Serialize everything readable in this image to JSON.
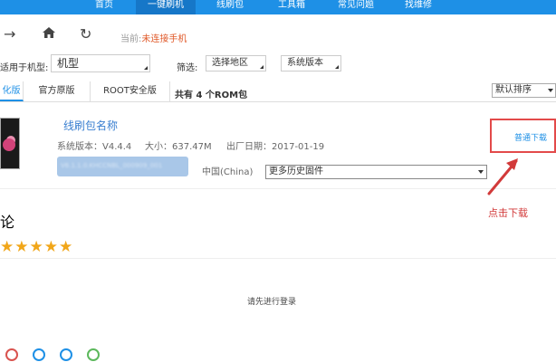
{
  "nav": {
    "items": [
      {
        "label": "首页",
        "active": false
      },
      {
        "label": "一键刷机",
        "active": true
      },
      {
        "label": "线刷包",
        "active": false
      },
      {
        "label": "工具箱",
        "active": false
      },
      {
        "label": "常见问题",
        "active": false
      },
      {
        "label": "找维修",
        "active": false
      }
    ]
  },
  "toolbar": {
    "status_label": "当前:",
    "status_value": "未连接手机",
    "search_placeholder": ""
  },
  "filters": {
    "model_label": "适用于机型:",
    "model_value": "机型",
    "filter_label": "筛选:",
    "region_value": "选择地区",
    "version_value": "系统版本"
  },
  "tabs": {
    "items": [
      "化版",
      "官方原版",
      "ROOT安全版"
    ],
    "count_text": "共有 4 个ROM包",
    "sort_value": "默认排序"
  },
  "rom": {
    "name": "线刷包名称",
    "system_version": "系统版本：V4.4.4",
    "size": "大小：637.47M",
    "release_date": "出厂日期：2017-01-19",
    "blurred_text": "V6.1.1.0.KHCCNBL_000909_001",
    "region": "中国(China)",
    "history_value": "更多历史固件",
    "download_label": "普通下载"
  },
  "annotation": {
    "text": "点击下载"
  },
  "section": {
    "title_char": "论",
    "stars": "★★★★★",
    "rating": 5
  },
  "login": {
    "text": "请先进行登录"
  },
  "colors": {
    "nav": "#1e90e6",
    "accent": "#1e90e6",
    "annotation": "#e34a4a",
    "stars": "#f1a619"
  }
}
